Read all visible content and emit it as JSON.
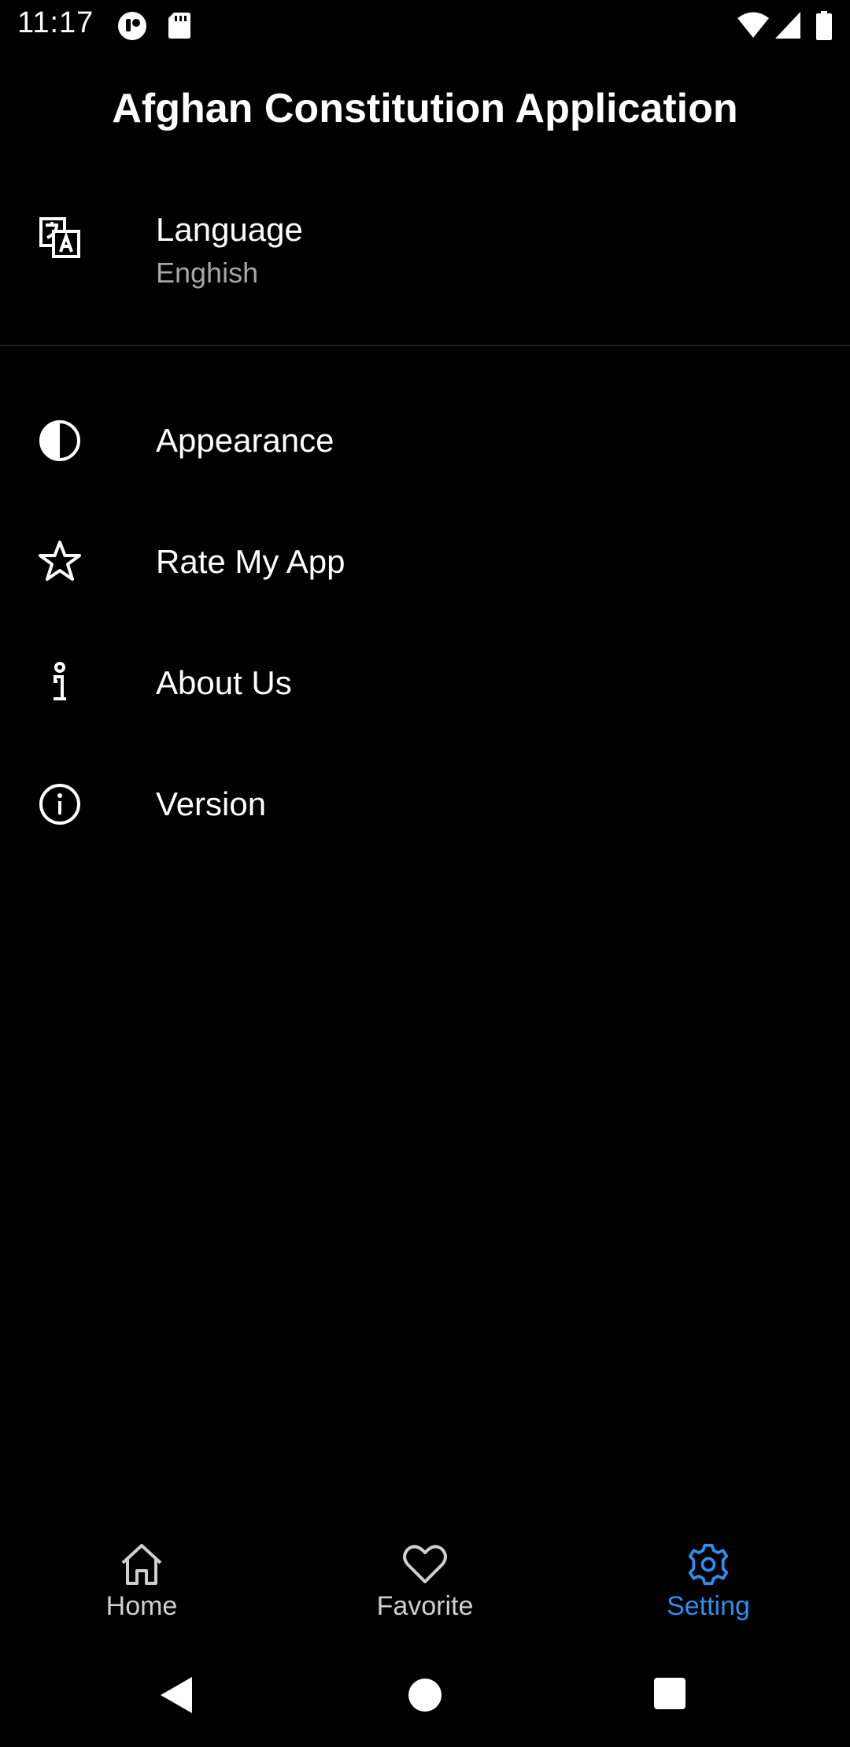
{
  "status_bar": {
    "time": "11:17",
    "icons": [
      "notification-icon",
      "sd-card-icon",
      "wifi-icon",
      "signal-icon",
      "battery-icon"
    ]
  },
  "header": {
    "title": "Afghan Constitution Application"
  },
  "settings": {
    "language": {
      "label": "Language",
      "value": "Enghish",
      "icon": "translate-icon"
    },
    "items": [
      {
        "label": "Appearance",
        "icon": "contrast-icon"
      },
      {
        "label": "Rate My App",
        "icon": "star-icon"
      },
      {
        "label": "About Us",
        "icon": "info-person-icon"
      },
      {
        "label": "Version",
        "icon": "info-circle-icon"
      }
    ]
  },
  "bottom_nav": {
    "items": [
      {
        "label": "Home",
        "icon": "home-icon",
        "active": false
      },
      {
        "label": "Favorite",
        "icon": "heart-icon",
        "active": false
      },
      {
        "label": "Setting",
        "icon": "gear-icon",
        "active": true
      }
    ],
    "active_color": "#2f8ef0",
    "inactive_color": "#cfcfcf"
  },
  "system_nav": {
    "icons": [
      "back-icon",
      "home-circle-icon",
      "recents-icon"
    ]
  }
}
